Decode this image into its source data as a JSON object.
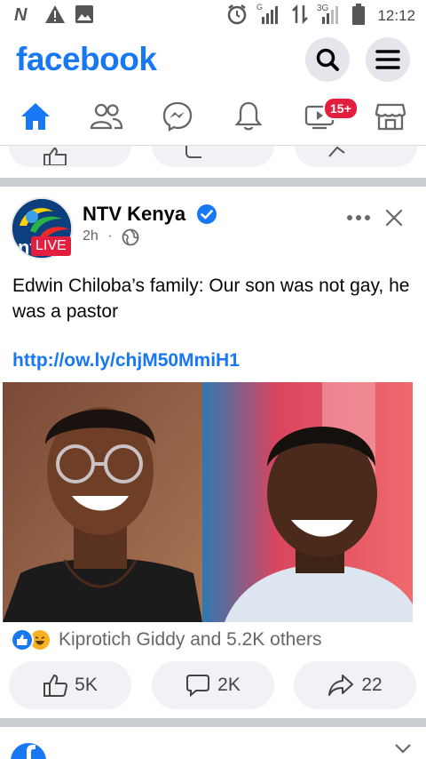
{
  "status_bar": {
    "icons": [
      "n-icon",
      "warning-icon",
      "image-icon",
      "alarm-icon",
      "signal-icon",
      "data-transfer-icon",
      "signal-3g-icon",
      "battery-icon"
    ],
    "network_g": "G",
    "network_3g": "3G",
    "time": "12:12"
  },
  "header": {
    "logo": "facebook",
    "search_icon": "search-icon",
    "menu_icon": "menu-icon"
  },
  "nav": {
    "items": [
      {
        "name": "home",
        "icon": "home-icon",
        "active": true
      },
      {
        "name": "friends",
        "icon": "friends-icon"
      },
      {
        "name": "messenger",
        "icon": "messenger-icon"
      },
      {
        "name": "notifications",
        "icon": "bell-icon"
      },
      {
        "name": "watch",
        "icon": "video-icon",
        "badge": "15+"
      },
      {
        "name": "marketplace",
        "icon": "marketplace-icon"
      }
    ],
    "active_color": "#1877f2"
  },
  "post": {
    "page_name": "NTV Kenya",
    "verified": true,
    "time": "2h",
    "separator_dot": "·",
    "live_label": "LIVE",
    "text": "Edwin Chiloba’s family: Our son was not gay, he was a pastor",
    "link": "http://ow.ly/chjM50MmiH1",
    "reactions": {
      "icons": [
        "like-icon",
        "haha-icon"
      ],
      "summary": "Kiprotich Giddy and 5.2K others"
    },
    "actions": {
      "likes": "5K",
      "comments": "2K",
      "shares": "22"
    }
  },
  "colors": {
    "brand": "#1877f2",
    "badge": "#e41e3f",
    "button_bg": "#f0f2f5",
    "secondary_text": "#65676b"
  }
}
